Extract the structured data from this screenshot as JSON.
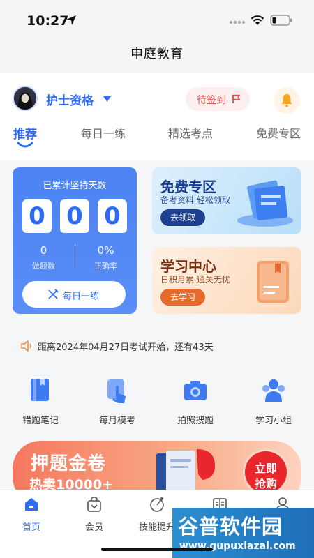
{
  "status_bar": {
    "time": "10:27"
  },
  "title": "申庭教育",
  "header": {
    "subject": "护士资格",
    "checkin_label": "待签到"
  },
  "tabs": [
    {
      "label": "推荐",
      "active": true
    },
    {
      "label": "每日一练"
    },
    {
      "label": "精选考点"
    },
    {
      "label": "免费专区"
    }
  ],
  "stats": {
    "title": "已累计坚持天数",
    "digits": [
      "0",
      "0",
      "0"
    ],
    "questions_value": "0",
    "questions_label": "做题数",
    "accuracy_value": "0%",
    "accuracy_label": "正确率",
    "practice_button": "每日一练"
  },
  "promos": {
    "free": {
      "title": "免费专区",
      "subtitle": "备考资料 轻松领取",
      "button": "去领取"
    },
    "study": {
      "title": "学习中心",
      "subtitle": "日积月累 通关无忧",
      "button": "去学习"
    }
  },
  "countdown": "距离2024年04月27日考试开始，还有43天",
  "tools": [
    {
      "label": "错题笔记",
      "icon": "notebook-icon"
    },
    {
      "label": "每月模考",
      "icon": "exam-touch-icon"
    },
    {
      "label": "拍照搜题",
      "icon": "camera-icon"
    },
    {
      "label": "学习小组",
      "icon": "group-icon"
    }
  ],
  "banner": {
    "title": "押题金卷",
    "subtitle": "热卖10000+",
    "buy_line1": "立即",
    "buy_line2": "抢购"
  },
  "bottom_nav": [
    {
      "label": "首页",
      "icon": "home-icon",
      "active": true
    },
    {
      "label": "会员",
      "icon": "vip-bag-icon"
    },
    {
      "label": "技能提升",
      "icon": "skill-icon"
    },
    {
      "label": "",
      "icon": "book-icon"
    },
    {
      "label": "",
      "icon": "profile-icon"
    }
  ],
  "watermark": {
    "title": "谷普软件园",
    "url": "www.gupuxlazal.com"
  },
  "colors": {
    "accent": "#2f6cf6",
    "danger": "#e9524f",
    "orange": "#f08a3c"
  }
}
